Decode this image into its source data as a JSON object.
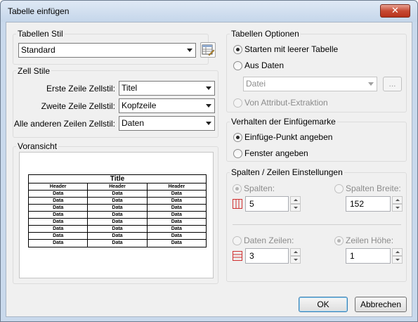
{
  "window": {
    "title": "Tabelle einfügen",
    "close_glyph": "✕"
  },
  "table_style": {
    "group_label": "Tabellen Stil",
    "selected": "Standard",
    "editor_icon": "table-style-editor-icon"
  },
  "cell_styles": {
    "group_label": "Zell Stile",
    "rows": [
      {
        "label": "Erste Zeile Zellstil:",
        "value": "Titel"
      },
      {
        "label": "Zweite Zeile Zellstil:",
        "value": "Kopfzeile"
      },
      {
        "label": "Alle anderen Zeilen Zellstil:",
        "value": "Daten"
      }
    ]
  },
  "preview": {
    "group_label": "Voransicht",
    "title": "Title",
    "headers": [
      "Header",
      "Header",
      "Header"
    ],
    "rows": [
      [
        "Data",
        "Data",
        "Data"
      ],
      [
        "Data",
        "Data",
        "Data"
      ],
      [
        "Data",
        "Data",
        "Data"
      ],
      [
        "Data",
        "Data",
        "Data"
      ],
      [
        "Data",
        "Data",
        "Data"
      ],
      [
        "Data",
        "Data",
        "Data"
      ],
      [
        "Data",
        "Data",
        "Data"
      ],
      [
        "Data",
        "Data",
        "Data"
      ]
    ]
  },
  "table_options": {
    "group_label": "Tabellen Optionen",
    "empty_table": "Starten mit leerer Tabelle",
    "from_data": "Aus Daten",
    "file_combo": "Datei",
    "browse_label": "...",
    "from_attribute": "Von Attribut-Extraktion"
  },
  "insertion_behavior": {
    "group_label": "Verhalten der Einfügemarke",
    "specify_point": "Einfüge-Punkt angeben",
    "specify_window": "Fenster angeben"
  },
  "columns_rows": {
    "group_label": "Spalten / Zeilen Einstellungen",
    "columns_label": "Spalten:",
    "columns_value": "5",
    "column_width_label": "Spalten Breite:",
    "column_width_value": "152",
    "data_rows_label": "Daten Zeilen:",
    "data_rows_value": "3",
    "row_height_label": "Zeilen Höhe:",
    "row_height_value": "1",
    "columns_icon": "columns-icon",
    "rows_icon": "rows-icon",
    "icon_color": "#d03030"
  },
  "buttons": {
    "ok": "OK",
    "cancel": "Abbrechen"
  }
}
